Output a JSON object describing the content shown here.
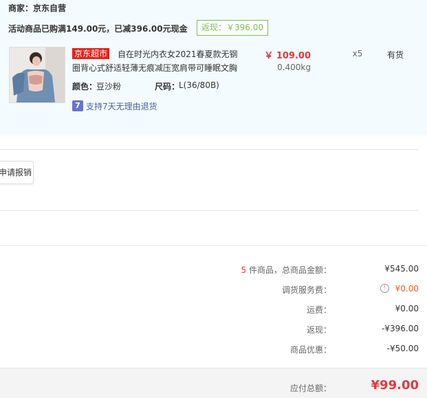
{
  "order": {
    "merchant": "商家：京东自营",
    "promo": "活动商品已购满149.00元，已减396.00元现金",
    "cashback_badge": "返现：￥396.00"
  },
  "product": {
    "tag": "京东超市",
    "title_line1": "自在时光内衣女2021春夏款无钢",
    "title_line2": "圈背心式舒适轻薄无痕减压宽肩带可睡眠文胸",
    "color_label": "颜色：",
    "color_value": "豆沙粉",
    "size_label": "尺码：",
    "size_value": "L(36/80B)",
    "price": "￥ 109.00",
    "weight": "0.400kg",
    "quantity": "x5",
    "stock": "有货",
    "return_icon_text": "7",
    "return_policy": "支持7天无理由退货",
    "thumbnail_icon": "product-photo-icon"
  },
  "actions": {
    "reimburse_label": "申请报销"
  },
  "summary": {
    "count": "5",
    "count_label": " 件商品，总商品金额：",
    "goods_total": "¥545.00",
    "service_fee_label": "调货服务费：",
    "service_fee": "¥0.00",
    "shipping_label": "运费：",
    "shipping": "¥0.00",
    "cashback_label": "返现：",
    "cashback": "-¥396.00",
    "discount_label": "商品优惠：",
    "discount": "-¥50.00",
    "payable_label": "应付总额：",
    "payable": "¥99.00"
  },
  "colors": {
    "accent_red": "#e4393c",
    "cashback_green": "#7abd54",
    "order_bg": "#f3fbfe",
    "link_blue": "#4a62a6",
    "fee_orange": "#f05d1f"
  }
}
